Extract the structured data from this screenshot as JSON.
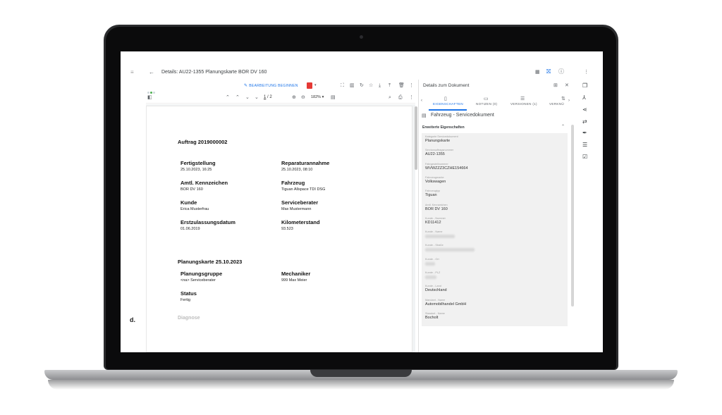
{
  "app": {
    "title": "Details: AU22-1355 Planungskarte BOR DV 160",
    "logo": "d."
  },
  "icons": {
    "menu": "hamburger-icon",
    "back": "arrow-left-icon",
    "apps": "grid-icon",
    "gift": "gift-icon",
    "help": "help-icon",
    "more": "more-vertical-icon"
  },
  "viewer": {
    "edit_button": "BEARBEITUNG BEGINNEN",
    "page_current": "1",
    "page_separator": "/",
    "page_total": "2",
    "zoom": "182%"
  },
  "document": {
    "heading1": "Auftrag 2019000002",
    "fields": [
      {
        "label": "Fertigstellung",
        "value": "25.10.2023, 16:25"
      },
      {
        "label": "Reparaturannahme",
        "value": "25.10.2023, 08:10"
      },
      {
        "label": "Amtl. Kennzeichen",
        "value": "BOR DV 160"
      },
      {
        "label": "Fahrzeug",
        "value": "Tiguan Allspace TDI DSG"
      },
      {
        "label": "Kunde",
        "value": "Erica Musterfrau"
      },
      {
        "label": "Serviceberater",
        "value": "Max Mustermann"
      },
      {
        "label": "Erstzulassungsdatum",
        "value": "01.06.2019"
      },
      {
        "label": "Kilometerstand",
        "value": "93.523"
      }
    ],
    "heading2": "Planungskarte 25.10.2023",
    "fields2": [
      {
        "label": "Planungsgruppe",
        "value": "<na> Serviceberater"
      },
      {
        "label": "Mechaniker",
        "value": "999 Max Meier"
      },
      {
        "label": "Status",
        "value": "Fertig"
      }
    ],
    "diagnose": "Diagnose"
  },
  "panel": {
    "title": "Details zum Dokument",
    "tabs": [
      {
        "label": "EIGENSCHAFTEN",
        "active": true
      },
      {
        "label": "NOTIZEN (0)",
        "active": false
      },
      {
        "label": "VERSIONEN (1)",
        "active": false
      },
      {
        "label": "VERKNÜ",
        "active": false
      }
    ],
    "doc_type": "Fahrzeug - Servicedokument",
    "section": "Erweiterte Eigenschaften",
    "props": [
      {
        "label": "Kategorie Servicedokument",
        "value": "Planungskarte"
      },
      {
        "label": "Serviceauftragsnummer",
        "value": "AU22-1355"
      },
      {
        "label": "Fahrgestellnummer",
        "value": "WVWZZZ3CZHE154664"
      },
      {
        "label": "Fahrzeugmarke",
        "value": "Volkswagen"
      },
      {
        "label": "Fahrzeugtyp",
        "value": "Tiguan"
      },
      {
        "label": "Amtl. Kennzeichen",
        "value": "BOR DV 160"
      },
      {
        "label": "Kunde - Nummer",
        "value": "KD11412"
      },
      {
        "label": "Kunde - Name",
        "value": ""
      },
      {
        "label": "Kunde - Straße",
        "value": ""
      },
      {
        "label": "Kunde - Ort",
        "value": ""
      },
      {
        "label": "Kunde - PLZ",
        "value": ""
      },
      {
        "label": "Kunde - Land",
        "value": "Deutschland"
      },
      {
        "label": "Mandant - Name",
        "value": "Automobilhandel GmbH"
      },
      {
        "label": "Standort - Name",
        "value": "Bocholt"
      }
    ]
  },
  "colors": {
    "accent": "#1a73e8",
    "pdf": "#e53935",
    "laptop": "#2b2c2e"
  }
}
